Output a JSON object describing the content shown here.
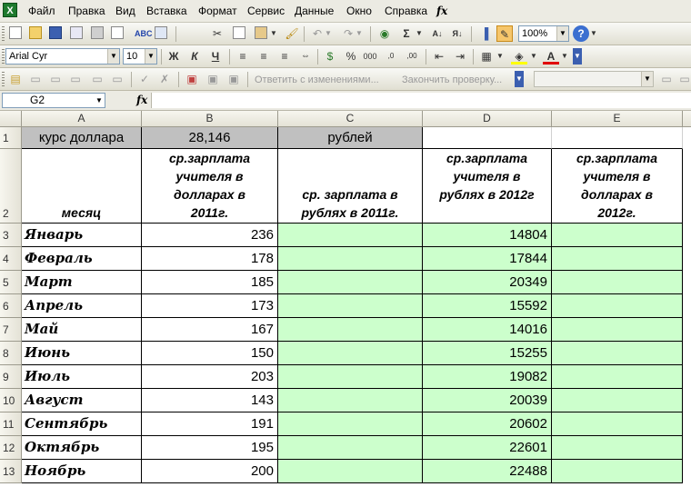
{
  "menu": [
    "Файл",
    "Правка",
    "Вид",
    "Вставка",
    "Формат",
    "Сервис",
    "Данные",
    "Окно",
    "Справка"
  ],
  "toolbar": {
    "zoom": "100%",
    "font_name": "Arial Cyr",
    "font_size": "10",
    "review_reply": "Ответить с изменениями...",
    "review_end": "Закончить проверку...",
    "bold": "Ж",
    "italic": "К",
    "underline": "Ч",
    "sum": "Σ"
  },
  "name_box": "G2",
  "formula_fx": "fx",
  "columns": [
    "A",
    "B",
    "C",
    "D",
    "E"
  ],
  "row_numbers": [
    "1",
    "2",
    "3",
    "4",
    "5",
    "6",
    "7",
    "8",
    "9",
    "10",
    "11",
    "12",
    "13"
  ],
  "row1": {
    "a": "курс доллара",
    "b": "28,146",
    "c": "рублей"
  },
  "row2": {
    "a": "месяц",
    "b": "ср.зарплата учителя в долларах в 2011г.",
    "c": "ср. зарплата в рублях в 2011г.",
    "d": "ср.зарплата учителя в рублях в 2012г",
    "e": "ср.зарплата учителя в долларах в 2012г."
  },
  "rows": [
    {
      "month": "Январь",
      "usd2011": "236",
      "rub2012": "14804"
    },
    {
      "month": "Февраль",
      "usd2011": "178",
      "rub2012": "17844"
    },
    {
      "month": "Март",
      "usd2011": "185",
      "rub2012": "20349"
    },
    {
      "month": "Апрель",
      "usd2011": "173",
      "rub2012": "15592"
    },
    {
      "month": "Май",
      "usd2011": "167",
      "rub2012": "14016"
    },
    {
      "month": "Июнь",
      "usd2011": "150",
      "rub2012": "15255"
    },
    {
      "month": "Июль",
      "usd2011": "203",
      "rub2012": "19082"
    },
    {
      "month": "Август",
      "usd2011": "143",
      "rub2012": "20039"
    },
    {
      "month": "Сентябрь",
      "usd2011": "191",
      "rub2012": "20602"
    },
    {
      "month": "Октябрь",
      "usd2011": "195",
      "rub2012": "22601"
    },
    {
      "month": "Ноябрь",
      "usd2011": "200",
      "rub2012": "22488"
    }
  ],
  "colors": {
    "gray_fill": "#c0c0c0",
    "green_fill": "#ccffcc",
    "chrome": "#ecebe3"
  }
}
